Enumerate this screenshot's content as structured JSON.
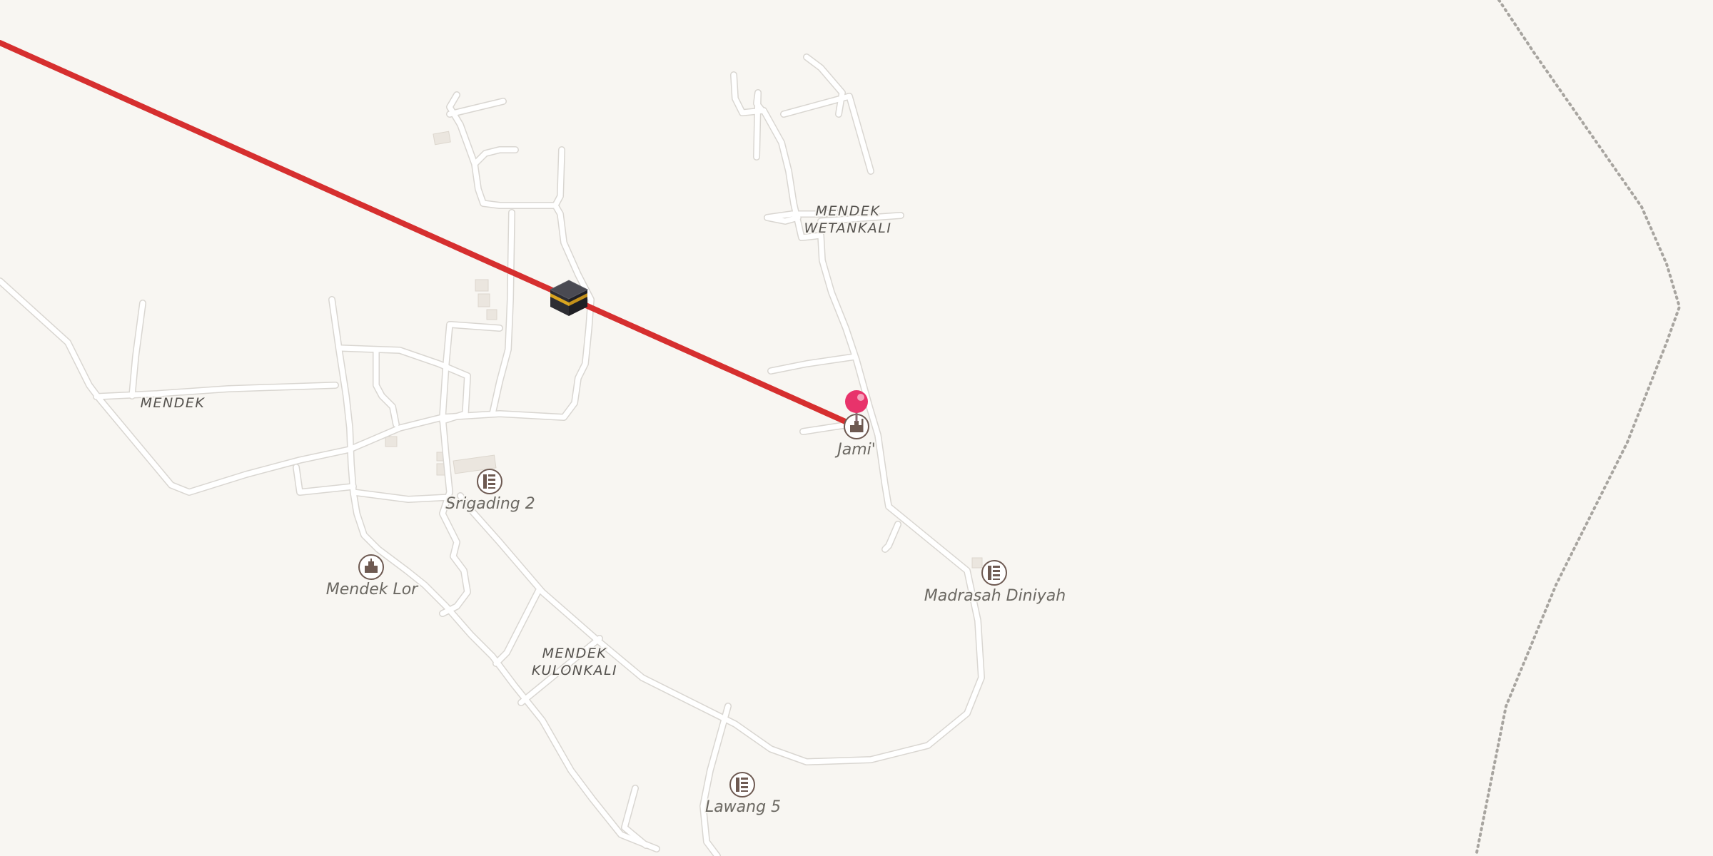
{
  "map": {
    "background_color": "#f8f6f2",
    "route_color": "#d62f2f",
    "pin_color": "#e8336b",
    "boundary_style": "dotted grey administrative boundary",
    "place_labels": {
      "mendek": "MENDEK",
      "mendek_wetankali_line1": "MENDEK",
      "mendek_wetankali_line2": "WETANKALI",
      "mendek_kulonkali_line1": "MENDEK",
      "mendek_kulonkali_line2": "KULONKALI"
    },
    "pois": {
      "jami": {
        "label": "Jami'",
        "icon": "mosque-icon"
      },
      "srigading2": {
        "label": "Srigading 2",
        "icon": "school-icon"
      },
      "mendek_lor": {
        "label": "Mendek Lor",
        "icon": "mosque-icon"
      },
      "madrasah_diniyah": {
        "label": "Madrasah Diniyah",
        "icon": "school-icon"
      },
      "lawang5": {
        "label": "Lawang 5",
        "icon": "school-icon"
      }
    },
    "markers": {
      "kaaba": {
        "icon": "kaaba-icon"
      },
      "pin": {
        "icon": "location-pin-icon"
      }
    }
  }
}
